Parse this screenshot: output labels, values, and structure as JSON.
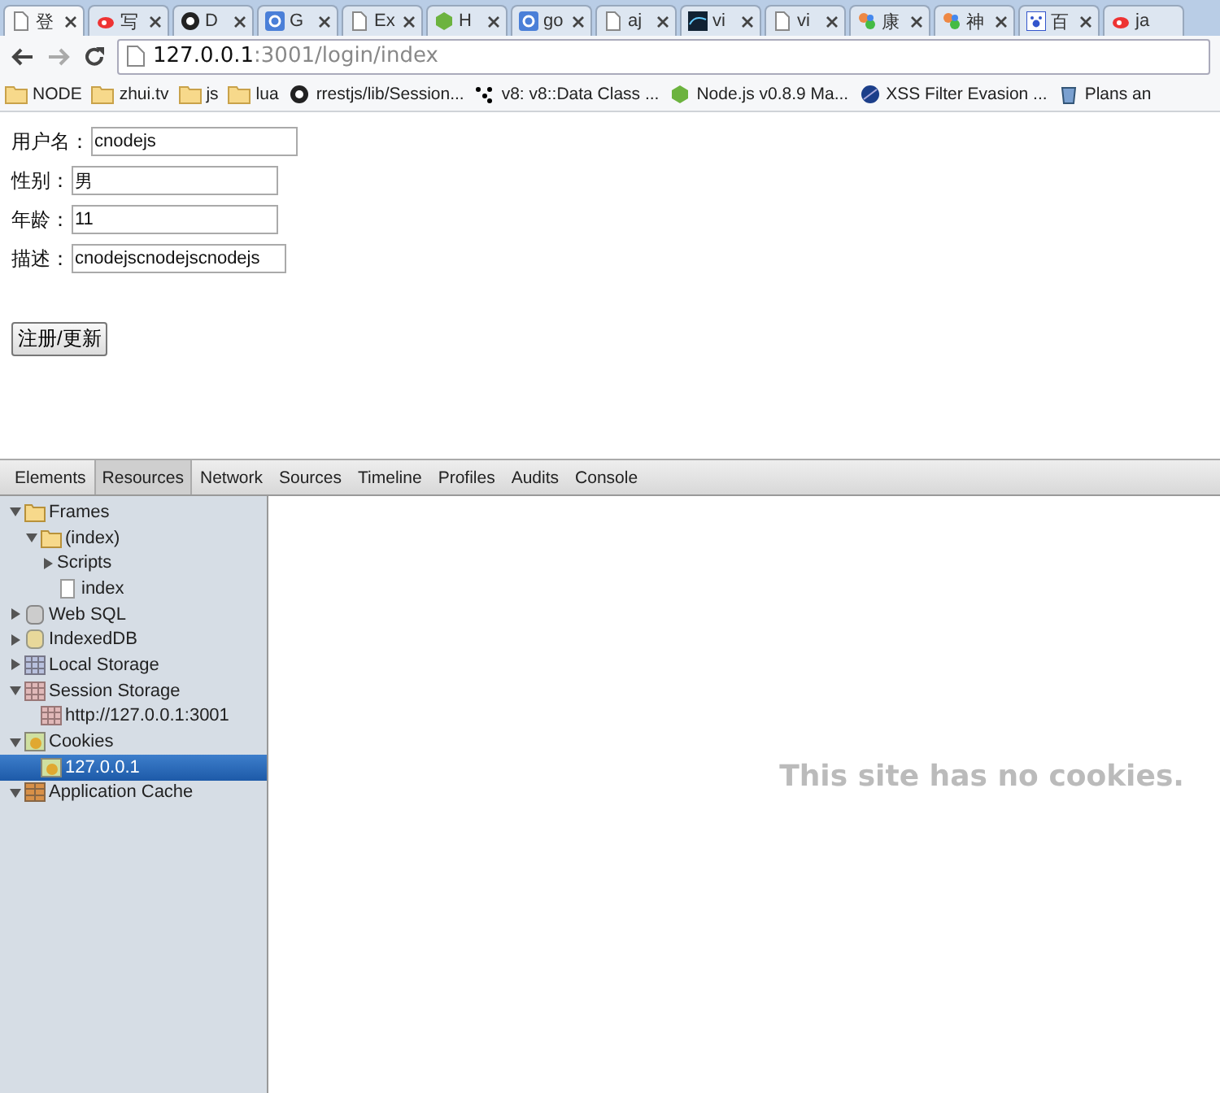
{
  "browser_tabs": [
    {
      "kind": "page",
      "title": "登",
      "selected": true,
      "closable": true
    },
    {
      "kind": "weibo",
      "title": "写",
      "selected": false,
      "closable": true
    },
    {
      "kind": "github",
      "title": "D",
      "selected": false,
      "closable": true
    },
    {
      "kind": "google",
      "title": "G",
      "selected": false,
      "closable": true
    },
    {
      "kind": "page",
      "title": "Ex",
      "selected": false,
      "closable": true
    },
    {
      "kind": "node",
      "title": "H",
      "selected": false,
      "closable": true
    },
    {
      "kind": "google",
      "title": "go",
      "selected": false,
      "closable": true
    },
    {
      "kind": "page",
      "title": "aj",
      "selected": false,
      "closable": true
    },
    {
      "kind": "wave",
      "title": "vi",
      "selected": false,
      "closable": true
    },
    {
      "kind": "page",
      "title": "vi",
      "selected": false,
      "closable": true
    },
    {
      "kind": "ninety-eight",
      "title": "康",
      "selected": false,
      "closable": true
    },
    {
      "kind": "ninety-eight",
      "title": "神",
      "selected": false,
      "closable": true
    },
    {
      "kind": "paw",
      "title": "百",
      "selected": false,
      "closable": true
    },
    {
      "kind": "weibo",
      "title": "ja",
      "selected": false,
      "closable": false
    }
  ],
  "address": {
    "host": "127.0.0.1",
    "rest": ":3001/login/index"
  },
  "bookmarks": [
    {
      "kind": "folder",
      "label": "NODE"
    },
    {
      "kind": "folder",
      "label": "zhui.tv"
    },
    {
      "kind": "folder",
      "label": "js"
    },
    {
      "kind": "folder",
      "label": "lua"
    },
    {
      "kind": "github",
      "label": "rrestjs/lib/Session..."
    },
    {
      "kind": "dots",
      "label": "v8: v8::Data Class ..."
    },
    {
      "kind": "node",
      "label": "Node.js v0.8.9 Ma..."
    },
    {
      "kind": "globe",
      "label": "XSS Filter Evasion ..."
    },
    {
      "kind": "bin",
      "label": "Plans an"
    }
  ],
  "form": {
    "fields": [
      {
        "label": "用户名：",
        "value": "cnodejs"
      },
      {
        "label": "性别：",
        "value": "男"
      },
      {
        "label": "年龄：",
        "value": "11"
      },
      {
        "label": "描述：",
        "value": "cnodejscnodejscnodejs"
      }
    ],
    "submit": "注册/更新"
  },
  "devtools": {
    "tabs": [
      {
        "label": "Elements",
        "selected": false
      },
      {
        "label": "Resources",
        "selected": true
      },
      {
        "label": "Network",
        "selected": false
      },
      {
        "label": "Sources",
        "selected": false
      },
      {
        "label": "Timeline",
        "selected": false
      },
      {
        "label": "Profiles",
        "selected": false
      },
      {
        "label": "Audits",
        "selected": false
      },
      {
        "label": "Console",
        "selected": false
      }
    ],
    "tree": [
      {
        "kind": "folder",
        "label": "Frames",
        "expanded": true,
        "selected": false,
        "children": [
          {
            "kind": "folder",
            "label": "(index)",
            "expanded": true,
            "selected": false,
            "children": [
              {
                "kind": "none",
                "label": "Scripts",
                "expanded": false,
                "selected": false
              },
              {
                "kind": "document",
                "label": "index",
                "selected": false
              }
            ]
          }
        ]
      },
      {
        "kind": "database",
        "label": "Web SQL",
        "expanded": false,
        "selected": false
      },
      {
        "kind": "indexeddb",
        "label": "IndexedDB",
        "expanded": false,
        "selected": false
      },
      {
        "kind": "grid",
        "label": "Local Storage",
        "expanded": false,
        "selected": false
      },
      {
        "kind": "redgrid",
        "label": "Session Storage",
        "expanded": true,
        "selected": false,
        "children": [
          {
            "kind": "redgrid",
            "label": "http://127.0.0.1:3001",
            "selected": false
          }
        ]
      },
      {
        "kind": "cookie",
        "label": "Cookies",
        "expanded": true,
        "selected": false,
        "children": [
          {
            "kind": "cookie",
            "label": "127.0.0.1",
            "selected": true
          }
        ]
      },
      {
        "kind": "cache",
        "label": "Application Cache",
        "expanded": true,
        "selected": false
      }
    ],
    "message": "This site has no cookies."
  }
}
